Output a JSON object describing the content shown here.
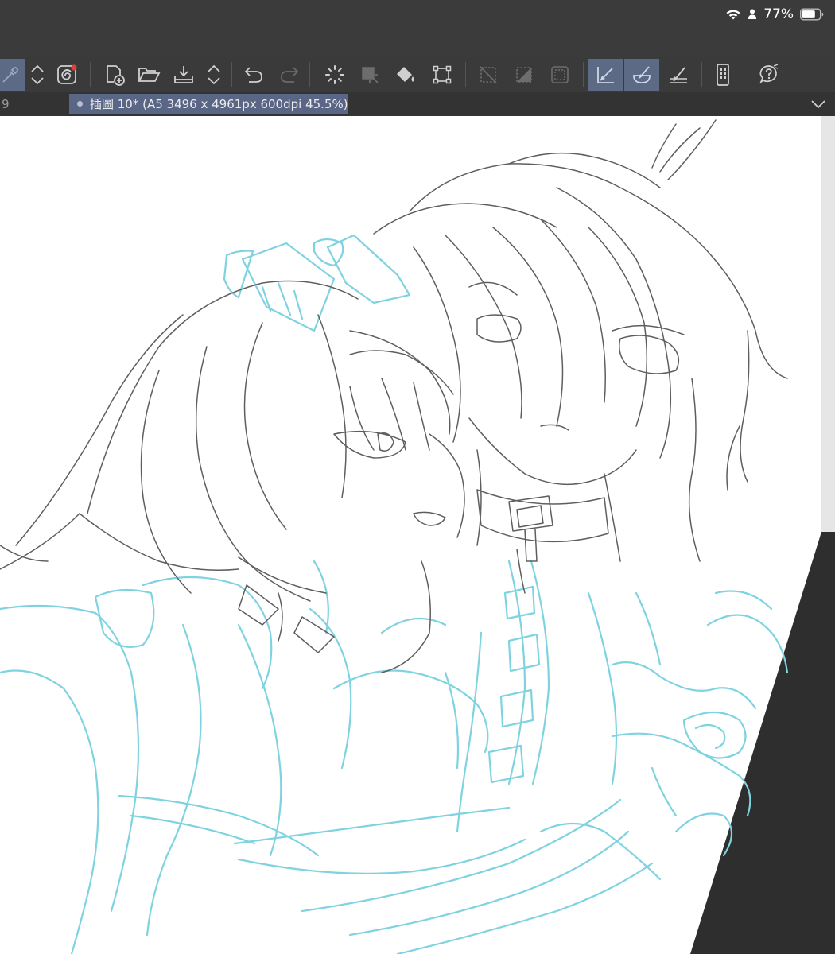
{
  "status_bar": {
    "battery_percent": "77%",
    "icons": [
      "wifi-icon",
      "person-icon",
      "battery-icon"
    ],
    "battery_level": 0.77
  },
  "toolbar": {
    "buttons": [
      {
        "name": "eyedropper-tool",
        "active": true
      },
      {
        "name": "scroll-up-down",
        "active": false
      },
      {
        "name": "quick-access",
        "active": false
      },
      {
        "name": "new-file",
        "active": false
      },
      {
        "name": "open-file",
        "active": false
      },
      {
        "name": "save-export",
        "active": false
      },
      {
        "name": "scroll-up-down",
        "active": false
      },
      {
        "name": "undo",
        "active": false
      },
      {
        "name": "redo",
        "active": false
      },
      {
        "name": "loading-spinner",
        "active": false
      },
      {
        "name": "selection-transform",
        "active": false
      },
      {
        "name": "fill",
        "active": false
      },
      {
        "name": "transform",
        "active": false
      },
      {
        "name": "clear-selection",
        "active": false
      },
      {
        "name": "invert-selection",
        "active": false
      },
      {
        "name": "selection-border",
        "active": false
      },
      {
        "name": "snap-to-ruler",
        "active": true
      },
      {
        "name": "snap-to-special-ruler",
        "active": true
      },
      {
        "name": "snap-to-grid",
        "active": false
      },
      {
        "name": "companion-mode",
        "active": false
      },
      {
        "name": "help",
        "active": false
      }
    ]
  },
  "tabs": {
    "previous_tab": "9",
    "active_tab": "插圖 10* (A5 3496 x 4961px 600dpi 45.5%)"
  },
  "colors": {
    "status_bg": "#3b3b3b",
    "toolbar_bg": "#3a3a3a",
    "active_button": "#5d6a86",
    "active_tab": "#5a6685",
    "canvas_paper": "#ffffff",
    "workspace": "#2e2e2e",
    "line_art": "#555555",
    "rough_sketch": "#7fd3e0"
  }
}
